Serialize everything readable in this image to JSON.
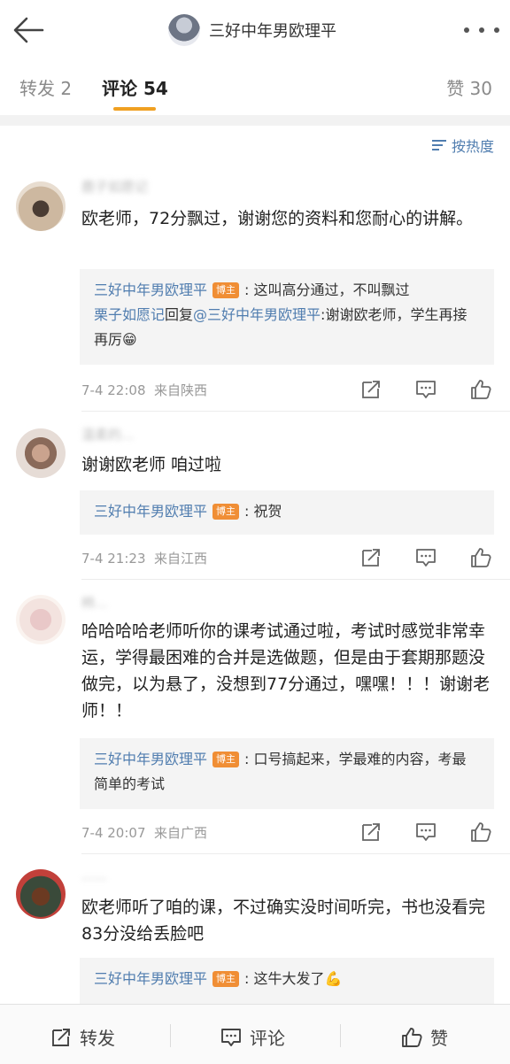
{
  "header": {
    "back_icon": "back-arrow-icon",
    "title": "三好中年男欧理平",
    "more_icon": "more-dots-icon"
  },
  "tabs": [
    {
      "label": "转发 2",
      "active": false
    },
    {
      "label": "评论 54",
      "active": true
    },
    {
      "label": "赞 30",
      "active": false
    }
  ],
  "accent_color": "#f0a021",
  "link_color": "#507daf",
  "sort": {
    "label": "按热度",
    "icon": "sort-icon"
  },
  "comments": [
    {
      "username": "鹿子如愿记",
      "text": "欧老师，72分飘过，谢谢您的资料和您耐心的讲解。",
      "replies": [
        {
          "author": "三好中年男欧理平",
          "badge": "博主",
          "text": ": 这叫高分通过，不叫飘过"
        },
        {
          "author": "栗子如愿记",
          "connector": "回复",
          "mention": "@三好中年男欧理平",
          "text": ":谢谢欧老师，学生再接再厉😁"
        }
      ],
      "time": "7-4 22:08",
      "location": "来自陕西"
    },
    {
      "username": "温柔的...",
      "text": "谢谢欧老师 咱过啦",
      "replies": [
        {
          "author": "三好中年男欧理平",
          "badge": "博主",
          "text": ": 祝贺"
        }
      ],
      "time": "7-4 21:23",
      "location": "来自江西"
    },
    {
      "username": "柿...",
      "text": "哈哈哈哈老师听你的课考试通过啦，考试时感觉非常幸运，学得最困难的合并是选做题，但是由于套期那题没做完，以为悬了，没想到77分通过，嘿嘿！！！谢谢老师！！",
      "replies": [
        {
          "author": "三好中年男欧理平",
          "badge": "博主",
          "text": ": 口号搞起来，学最难的内容，考最简单的考试"
        }
      ],
      "time": "7-4 20:07",
      "location": "来自广西"
    },
    {
      "username": "......",
      "text": "欧老师听了咱的课，不过确实没时间听完，书也没看完83分没给丢脸吧",
      "replies": [
        {
          "author": "三好中年男欧理平",
          "badge": "博主",
          "text": ": 这牛大发了💪"
        }
      ]
    }
  ],
  "action_icons": [
    "share-icon",
    "comment-icon",
    "like-icon"
  ],
  "bottom_bar": {
    "forward_label": "转发",
    "comment_label": "评论",
    "like_label": "赞"
  }
}
